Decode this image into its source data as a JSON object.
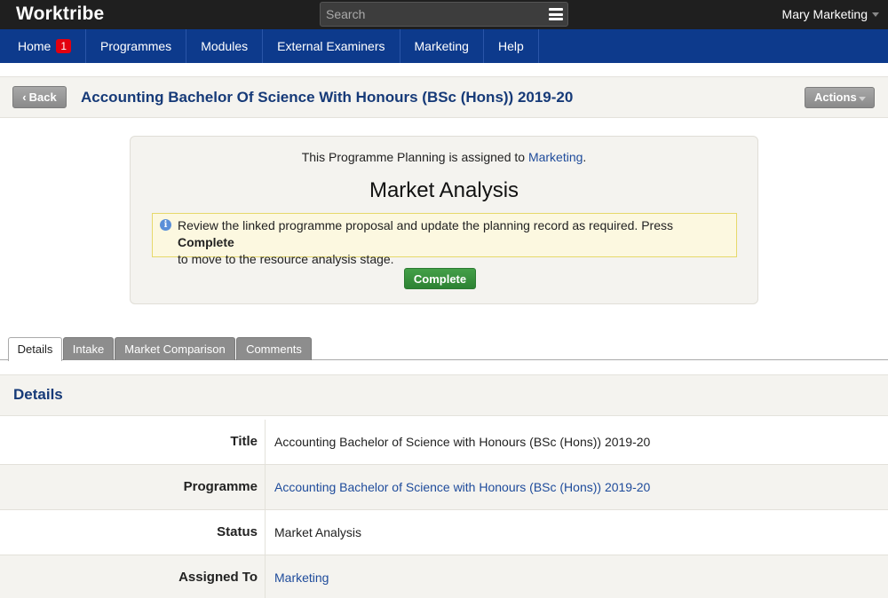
{
  "brand": {
    "name": "Worktribe",
    "tm": "™"
  },
  "search": {
    "placeholder": "Search"
  },
  "user": {
    "name": "Mary Marketing"
  },
  "nav": {
    "items": [
      {
        "label": "Home",
        "badge": "1"
      },
      {
        "label": "Programmes"
      },
      {
        "label": "Modules"
      },
      {
        "label": "External Examiners"
      },
      {
        "label": "Marketing"
      },
      {
        "label": "Help"
      }
    ]
  },
  "header": {
    "back_label": "Back",
    "title": "Accounting Bachelor Of Science With Honours (BSc (Hons)) 2019-20",
    "actions_label": "Actions"
  },
  "workflow": {
    "assigned_prefix": "This Programme Planning is assigned to ",
    "assigned_to": "Marketing",
    "assigned_suffix": ".",
    "stage": "Market Analysis",
    "info_text_1": "Review the linked programme proposal and update the planning record as required. Press ",
    "info_bold": "Complete",
    "info_text_2": "to move to the resource analysis stage.",
    "complete_label": "Complete"
  },
  "tabs": [
    {
      "label": "Details",
      "active": true
    },
    {
      "label": "Intake"
    },
    {
      "label": "Market Comparison"
    },
    {
      "label": "Comments"
    }
  ],
  "details": {
    "heading": "Details",
    "rows": [
      {
        "label": "Title",
        "value": "Accounting Bachelor of Science with Honours (BSc (Hons)) 2019-20"
      },
      {
        "label": "Programme",
        "value": "Accounting Bachelor of Science with Honours (BSc (Hons)) 2019-20"
      },
      {
        "label": "Status",
        "value": "Market Analysis"
      },
      {
        "label": "Assigned To",
        "value": "Marketing"
      }
    ]
  },
  "colors": {
    "topbar": "#1f1f1f",
    "navbar": "#0d3a8c",
    "title_blue": "#163a78",
    "link_blue": "#1e4b9b",
    "complete_green": "#2d8233",
    "badge_red": "#e3000f",
    "info_yellow": "#fcf8e0"
  }
}
